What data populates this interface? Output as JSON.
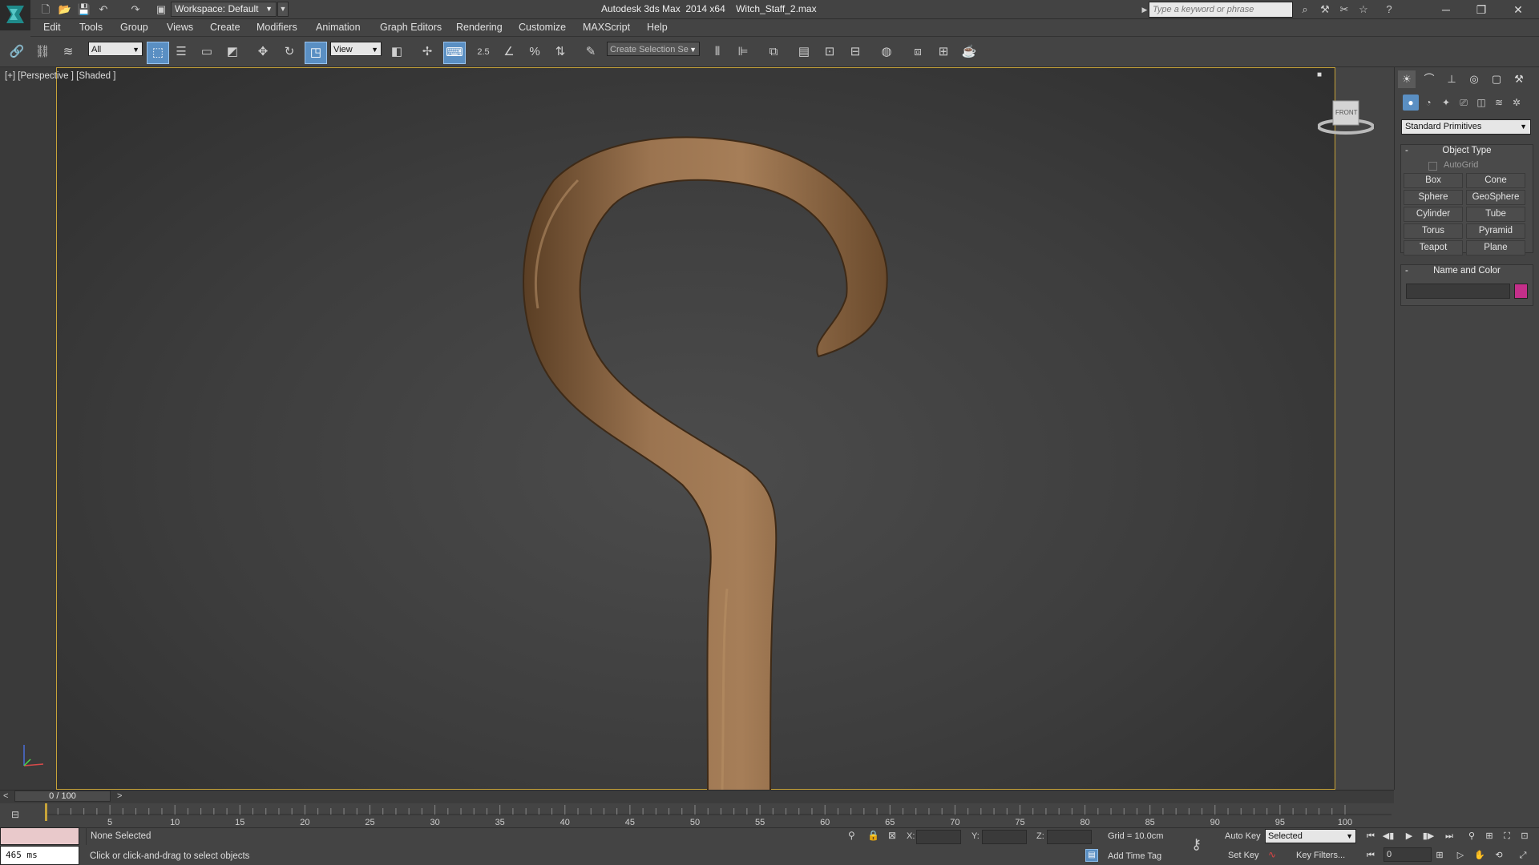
{
  "app": {
    "title": "Autodesk 3ds Max  2014 x64    Witch_Staff_2.max",
    "workspace": "Workspace: Default",
    "search_placeholder": "Type a keyword or phrase",
    "window_buttons": {
      "minimize": "─",
      "restore": "❐",
      "close": "✕"
    }
  },
  "menu": [
    "Edit",
    "Tools",
    "Group",
    "Views",
    "Create",
    "Modifiers",
    "Animation",
    "Graph Editors",
    "Rendering",
    "Customize",
    "MAXScript",
    "Help"
  ],
  "toolbar": {
    "selection_filter": "All",
    "reference_coord": "View",
    "snap_value": "2.5",
    "named_selection_placeholder": "Create Selection Se"
  },
  "viewport": {
    "label": "[+] [Perspective ] [Shaded ]",
    "viewcube_face": "FRONT",
    "highlight_color": "#c7a339"
  },
  "command_panel": {
    "category_dropdown": "Standard Primitives",
    "object_type": {
      "title": "Object Type",
      "autogrid": "AutoGrid",
      "buttons": [
        "Box",
        "Cone",
        "Sphere",
        "GeoSphere",
        "Cylinder",
        "Tube",
        "Torus",
        "Pyramid",
        "Teapot",
        "Plane"
      ]
    },
    "name_and_color": {
      "title": "Name and Color",
      "name_value": "",
      "color": "#c42f8a"
    }
  },
  "timeline": {
    "frame_counter": "0 / 100",
    "prev": "<",
    "next": ">",
    "ticks": [
      "5",
      "10",
      "15",
      "20",
      "25",
      "30",
      "35",
      "40",
      "45",
      "50",
      "55",
      "60",
      "65",
      "70",
      "75",
      "80",
      "85",
      "90",
      "95",
      "100"
    ]
  },
  "status": {
    "maxscript_time": "465 ms",
    "selection": "None Selected",
    "prompt": "Click or click-and-drag to select objects",
    "x_label": "X:",
    "y_label": "Y:",
    "z_label": "Z:",
    "grid": "Grid = 10.0cm",
    "add_time_tag": "Add Time Tag",
    "auto_key": "Auto Key",
    "set_key": "Set Key",
    "key_mode": "Selected",
    "key_filters": "Key Filters...",
    "current_frame": "0"
  }
}
